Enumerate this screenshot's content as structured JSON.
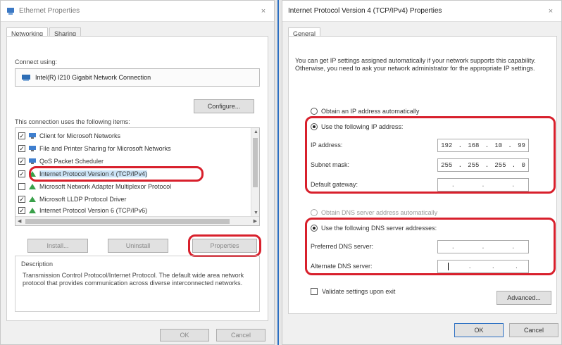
{
  "left_window": {
    "title": "Ethernet Properties",
    "close_glyph": "×",
    "tabs": [
      "Networking",
      "Sharing"
    ],
    "connect_using_label": "Connect using:",
    "adapter_name": "Intel(R) I210 Gigabit Network Connection",
    "configure_label": "Configure...",
    "items_label": "This connection uses the following items:",
    "items": [
      {
        "checked": true,
        "label": "Client for Microsoft Networks",
        "icon": "network-client-icon"
      },
      {
        "checked": true,
        "label": "File and Printer Sharing for Microsoft Networks",
        "icon": "network-service-icon"
      },
      {
        "checked": true,
        "label": "QoS Packet Scheduler",
        "icon": "network-service-icon"
      },
      {
        "checked": true,
        "label": "Internet Protocol Version 4 (TCP/IPv4)",
        "icon": "protocol-icon"
      },
      {
        "checked": false,
        "label": "Microsoft Network Adapter Multiplexor Protocol",
        "icon": "protocol-icon"
      },
      {
        "checked": true,
        "label": "Microsoft LLDP Protocol Driver",
        "icon": "protocol-icon"
      },
      {
        "checked": true,
        "label": "Internet Protocol Version 6 (TCP/IPv6)",
        "icon": "protocol-icon"
      }
    ],
    "install_label": "Install...",
    "uninstall_label": "Uninstall",
    "properties_label": "Properties",
    "description_label": "Description",
    "description_text": "Transmission Control Protocol/Internet Protocol. The default wide area network protocol that provides communication across diverse interconnected networks.",
    "ok_label": "OK",
    "cancel_label": "Cancel"
  },
  "right_window": {
    "title": "Internet Protocol Version 4 (TCP/IPv4) Properties",
    "close_glyph": "×",
    "tabs": [
      "General"
    ],
    "intro": "You can get IP settings assigned automatically if your network supports this capability. Otherwise, you need to ask your network administrator for the appropriate IP settings.",
    "obtain_ip_auto_label": "Obtain an IP address automatically",
    "use_following_ip_label": "Use the following IP address:",
    "ip_address_label": "IP address:",
    "ip_address_value": [
      "192",
      "168",
      "10",
      "99"
    ],
    "subnet_mask_label": "Subnet mask:",
    "subnet_mask_value": [
      "255",
      "255",
      "255",
      "0"
    ],
    "default_gateway_label": "Default gateway:",
    "default_gateway_value": [
      "",
      "",
      "",
      ""
    ],
    "obtain_dns_auto_label": "Obtain DNS server address automatically",
    "use_following_dns_label": "Use the following DNS server addresses:",
    "preferred_dns_label": "Preferred DNS server:",
    "alternate_dns_label": "Alternate DNS server:",
    "validate_label": "Validate settings upon exit",
    "advanced_label": "Advanced...",
    "ok_label": "OK",
    "cancel_label": "Cancel"
  },
  "colors": {
    "highlight_ring": "#d8202c",
    "accent_line": "#2b6fc2"
  }
}
